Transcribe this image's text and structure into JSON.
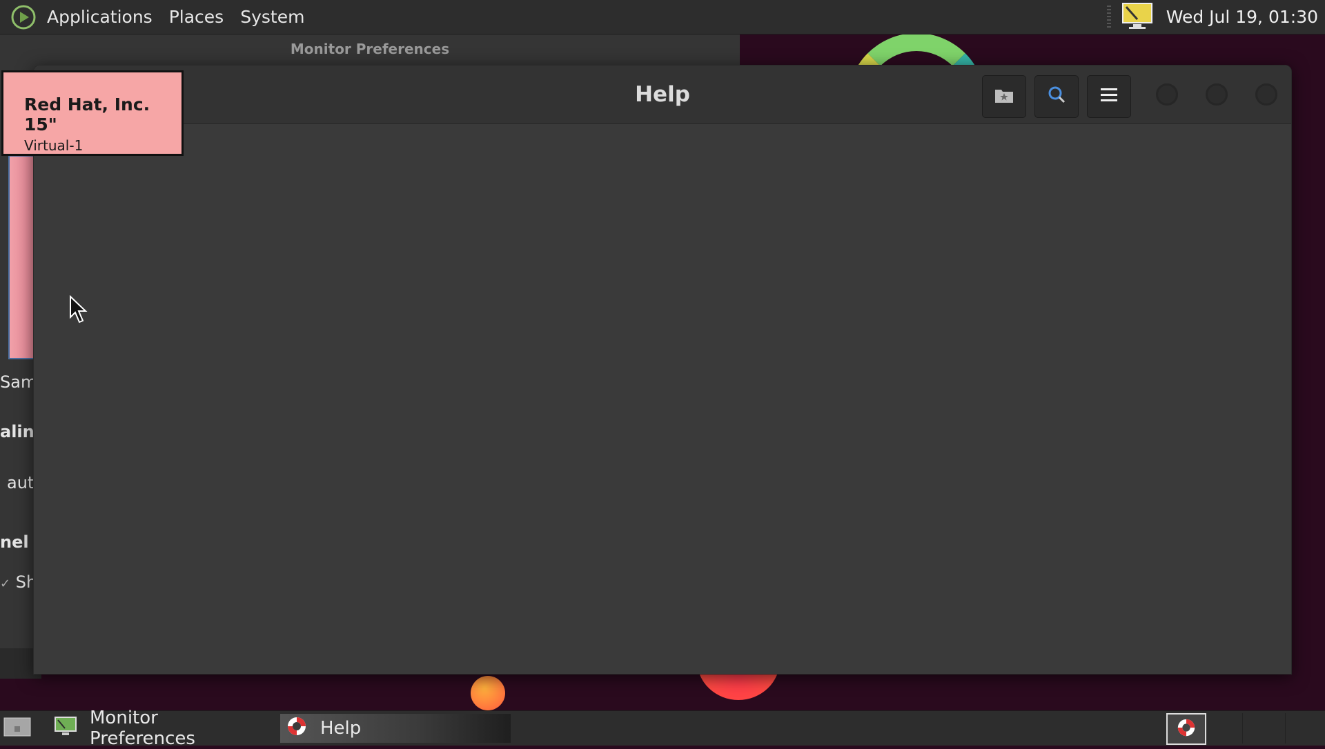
{
  "top_panel": {
    "menus": [
      "Applications",
      "Places",
      "System"
    ],
    "clock": "Wed Jul 19, 01:30"
  },
  "monitor_prefs": {
    "title": "Monitor Preferences",
    "fragments": [
      "Sam",
      "alin",
      "aut",
      "nel",
      "Sh"
    ],
    "check_mark": "✓"
  },
  "monitor_label": {
    "name": "Red Hat, Inc. 15\"",
    "connector": "Virtual-1"
  },
  "help_window": {
    "title": "Help"
  },
  "taskbar": {
    "tasks": [
      {
        "label": "Monitor Preferences",
        "icon": "monitor-prefs-icon"
      },
      {
        "label": "Help",
        "icon": "help-lifebuoy-icon"
      }
    ]
  },
  "colors": {
    "panel_bg": "#2d2d2d",
    "desktop_bg": "#2a0a1e",
    "monitor_label_bg": "#f6a6a6",
    "help_bg": "#3a3a3a"
  }
}
